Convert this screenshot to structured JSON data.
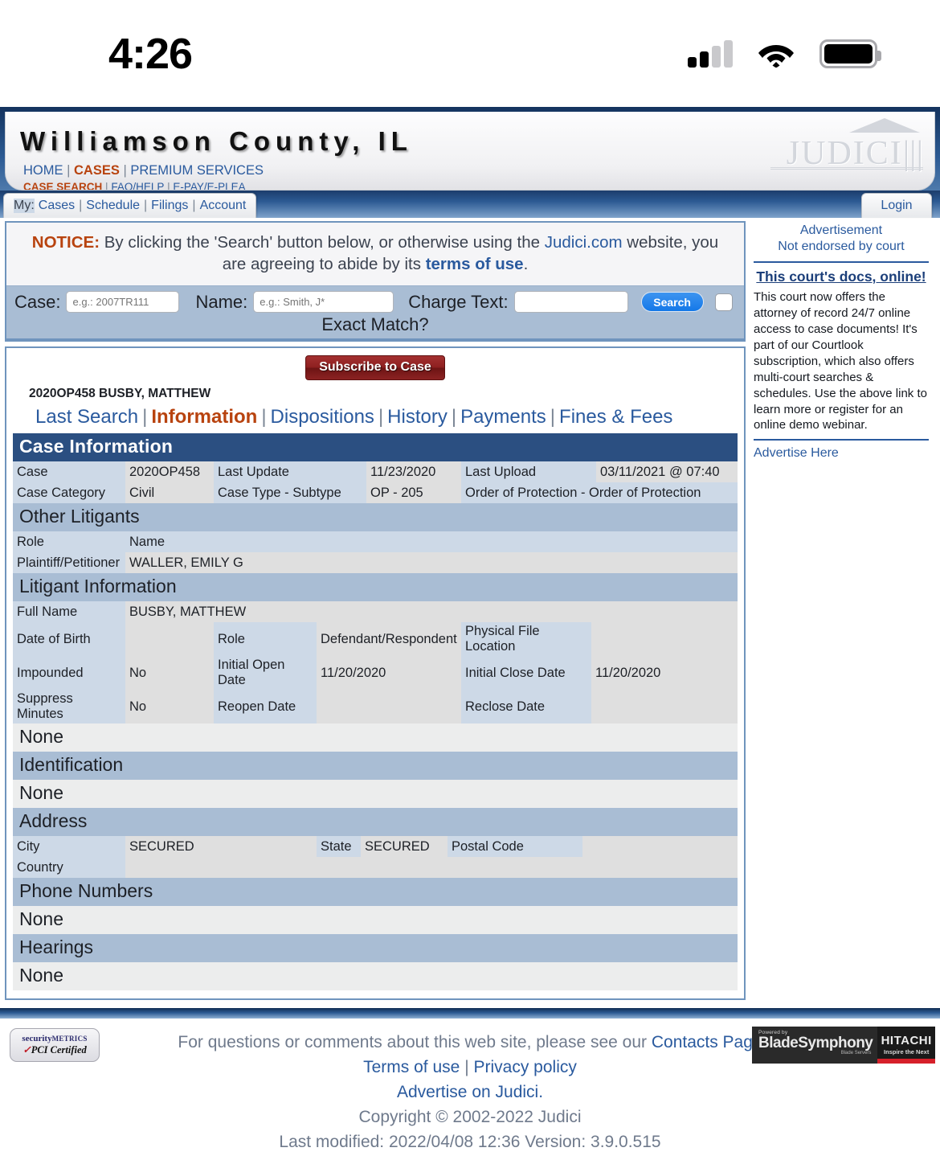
{
  "statusbar": {
    "time": "4:26",
    "signal_icon": "cellular-signal-icon",
    "wifi_icon": "wifi-icon",
    "battery_icon": "battery-icon"
  },
  "header": {
    "county_title": "Williamson County, IL",
    "nav_primary": [
      {
        "label": "HOME",
        "active": false
      },
      {
        "label": "CASES",
        "active": true
      },
      {
        "label": "PREMIUM SERVICES",
        "active": false
      }
    ],
    "nav_secondary": [
      {
        "label": "CASE SEARCH",
        "active": true
      },
      {
        "label": "FAQ/HELP",
        "active": false
      },
      {
        "label": "E-PAY/E-PLEA",
        "active": false
      }
    ],
    "logo_text": "JUDICI",
    "separator": "|"
  },
  "mybar": {
    "prefix": "My:",
    "items": [
      "Cases",
      "Schedule",
      "Filings",
      "Account"
    ],
    "separator": "|",
    "login_label": "Login"
  },
  "notice": {
    "label": "NOTICE:",
    "text_1": " By clicking the 'Search' button below, or otherwise using the ",
    "link_judici": "Judici.com",
    "text_2": " website, you are agreeing to abide by its ",
    "link_terms": "terms of use",
    "text_3": "."
  },
  "search": {
    "case_label": "Case:",
    "case_placeholder": "e.g.: 2007TR111",
    "case_value": "",
    "name_label": "Name:",
    "name_placeholder": "e.g.: Smith, J*",
    "name_value": "",
    "charge_label": "Charge Text:",
    "charge_placeholder": "",
    "charge_value": "",
    "search_button": "Search",
    "exact_match_label": "Exact Match?"
  },
  "case": {
    "subscribe_button": "Subscribe to Case",
    "case_header": "2020OP458  BUSBY, MATTHEW",
    "tabs": [
      {
        "label": "Last Search",
        "active": false
      },
      {
        "label": "Information",
        "active": true
      },
      {
        "label": "Dispositions",
        "active": false
      },
      {
        "label": "History",
        "active": false
      },
      {
        "label": "Payments",
        "active": false
      },
      {
        "label": "Fines & Fees",
        "active": false
      }
    ],
    "tab_separator": "|",
    "sections": {
      "case_information": {
        "title": "Case Information",
        "rows": [
          {
            "l1": "Case",
            "v1": "2020OP458",
            "l2": "Last Update",
            "v2": "11/23/2020",
            "l3": "Last Upload",
            "v3": "03/11/2021 @ 07:40"
          },
          {
            "l1": "Case Category",
            "v1": "Civil",
            "l2": "Case Type - Subtype",
            "v2": "OP - 205",
            "l3": "Order of Protection - Order of Protection",
            "v3": ""
          }
        ]
      },
      "other_litigants": {
        "title": "Other Litigants",
        "col_role": "Role",
        "col_name": "Name",
        "rows": [
          {
            "role": "Plaintiff/Petitioner",
            "name": "WALLER, EMILY G"
          }
        ]
      },
      "litigant_information": {
        "title": "Litigant Information",
        "full_name_label": "Full Name",
        "full_name_value": "BUSBY, MATTHEW",
        "dob_label": "Date of Birth",
        "dob_value": "",
        "role_label": "Role",
        "role_value": "Defendant/Respondent",
        "file_location_label": "Physical File Location",
        "file_location_value": "",
        "impounded_label": "Impounded",
        "impounded_value": "No",
        "initial_open_label": "Initial Open Date",
        "initial_open_value": "11/20/2020",
        "initial_close_label": "Initial Close Date",
        "initial_close_value": "11/20/2020",
        "suppress_label": "Suppress Minutes",
        "suppress_value": "No",
        "reopen_label": "Reopen Date",
        "reopen_value": "",
        "reclose_label": "Reclose Date",
        "reclose_value": "",
        "none": "None"
      },
      "identification": {
        "title": "Identification",
        "none": "None"
      },
      "address": {
        "title": "Address",
        "city_label": "City",
        "city_value": "SECURED",
        "state_label": "State",
        "state_value": "SECURED",
        "postal_label": "Postal Code",
        "postal_value": "",
        "country_label": "Country",
        "country_value": ""
      },
      "phone_numbers": {
        "title": "Phone Numbers",
        "none": "None"
      },
      "hearings": {
        "title": "Hearings",
        "none": "None"
      }
    }
  },
  "ad": {
    "line1": "Advertisement",
    "line2": "Not endorsed by court",
    "headline": "This court's docs, online!",
    "body": "This court now offers the attorney of record 24/7 online access to case documents! It's part of our Courtlook subscription, which also offers multi-court searches & schedules. Use the above link to learn more or register for an online demo webinar.",
    "advertise_here": "Advertise Here"
  },
  "footer": {
    "line1_pre": "For questions or comments about this web site, please see our ",
    "line1_link": "Contacts Page",
    "terms": "Terms of use",
    "privacy": "Privacy policy",
    "separator": "|",
    "advertise": "Advertise on Judici.",
    "copyright": "Copyright © 2002-2022 Judici",
    "lastmod": "Last modified: 2022/04/08 12:36 Version: 3.9.0.515",
    "pci_line1": "security",
    "pci_line1_sm": "METRICS",
    "pci_line2": "PCI Certified",
    "blade_powered": "Powered by",
    "blade_name": "BladeSymphony",
    "blade_sub": "Blade Servers",
    "hitachi_name": "HITACHI",
    "hitachi_tag": "Inspire the Next"
  },
  "colors": {
    "accent_orange": "#b8430f",
    "link_blue": "#2a5a9e",
    "section_header_navy": "#2b4f81",
    "subheader_blue": "#a9bdd4",
    "label_cell": "#cdd9e7",
    "value_cell": "#dfdfdf",
    "subscribe_red": "#8e2020"
  }
}
